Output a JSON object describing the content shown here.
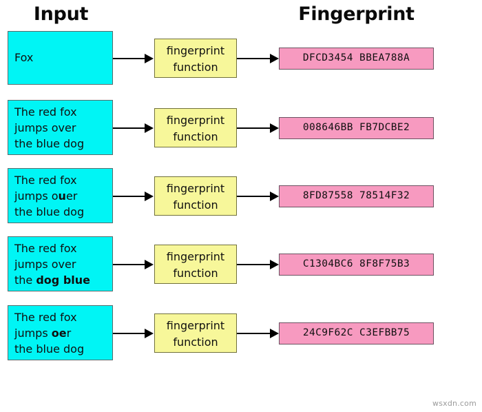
{
  "headers": {
    "input": "Input",
    "fingerprint": "Fingerprint"
  },
  "function_box": {
    "line1": "fingerprint",
    "line2": "function"
  },
  "colors": {
    "input_fill": "#00f5f5",
    "function_fill": "#f7f79a",
    "output_fill": "#f79ac0",
    "background": "#ffffff",
    "arrow": "#000000",
    "text": "#101010"
  },
  "rows": [
    {
      "input_lines": [
        [
          {
            "text": "Fox",
            "bold": false
          }
        ]
      ],
      "fingerprint": "DFCD3454 BBEA788A"
    },
    {
      "input_lines": [
        [
          {
            "text": "The red fox",
            "bold": false
          }
        ],
        [
          {
            "text": "jumps over",
            "bold": false
          }
        ],
        [
          {
            "text": "the blue dog",
            "bold": false
          }
        ]
      ],
      "fingerprint": "008646BB FB7DCBE2"
    },
    {
      "input_lines": [
        [
          {
            "text": "The red fox",
            "bold": false
          }
        ],
        [
          {
            "text": "jumps o",
            "bold": false
          },
          {
            "text": "u",
            "bold": true
          },
          {
            "text": "er",
            "bold": false
          }
        ],
        [
          {
            "text": "the blue dog",
            "bold": false
          }
        ]
      ],
      "fingerprint": "8FD87558 78514F32"
    },
    {
      "input_lines": [
        [
          {
            "text": "The red fox",
            "bold": false
          }
        ],
        [
          {
            "text": "jumps over",
            "bold": false
          }
        ],
        [
          {
            "text": "the ",
            "bold": false
          },
          {
            "text": "dog blue",
            "bold": true
          }
        ]
      ],
      "fingerprint": "C1304BC6 8F8F75B3"
    },
    {
      "input_lines": [
        [
          {
            "text": "The red fox",
            "bold": false
          }
        ],
        [
          {
            "text": "jumps ",
            "bold": false
          },
          {
            "text": "oe",
            "bold": true
          },
          {
            "text": "r",
            "bold": false
          }
        ],
        [
          {
            "text": "the blue dog",
            "bold": false
          }
        ]
      ],
      "fingerprint": "24C9F62C C3EFBB75"
    }
  ],
  "watermark": "wsxdn.com"
}
